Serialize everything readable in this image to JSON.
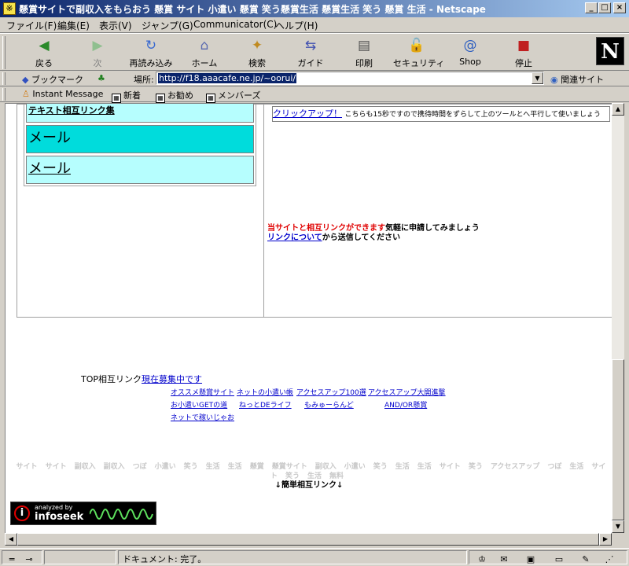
{
  "window": {
    "title": "懸賞サイトで副収入をもらおう 懸賞 サイト 小遣い 懸賞 笑う懸賞生活 懸賞生活 笑う 懸賞 生活 - Netscape",
    "minimize": "_",
    "maximize": "□",
    "close": "×"
  },
  "menu": [
    "ファイル(F)",
    "編集(E)",
    "表示(V)",
    "ジャンプ(G)",
    "Communicator(C)",
    "ヘルプ(H)"
  ],
  "toolbar": {
    "back": "戻る",
    "forward": "次",
    "reload": "再読み込み",
    "home": "ホーム",
    "search": "検索",
    "guide": "ガイド",
    "print": "印刷",
    "security": "セキュリティ",
    "shop": "Shop",
    "stop": "停止",
    "logo": "N"
  },
  "location": {
    "bookmarks": "ブックマーク",
    "label": "場所:",
    "url": "http://f18.aaacafe.ne.jp/~oorui/",
    "related": "関連サイト"
  },
  "personal": {
    "instant_message": "Instant Message",
    "new": "新着",
    "recommend": "お勧め",
    "members": "メンバーズ"
  },
  "page": {
    "left_cell1": "テキスト相互リンク集",
    "left_cell2": "メール",
    "left_cell3": "メール",
    "click_link": "クリックアップ！",
    "click_text": "こちらも15秒ですので携待時間をずらして上のツールとへ平行して使いましょう",
    "sogo_red": "当サイトと相互リンクができます",
    "sogo_black": "気軽に申請してみましょう",
    "link_about": "リンクについて",
    "link_about_rest": "から送信してください",
    "top_label": "TOP相互リンク",
    "top_now": "現在募集中です",
    "top_links": [
      "オススメ懸賞サイト",
      "ネットの小遣い帳",
      "アクセスアップ100選",
      "アクセスアップ大開進撃",
      "お小遣いGETの道",
      "ねっとDEライフ",
      "もみゅーらんど",
      "AND/OR懸賞",
      "ネットで稼いじゃお"
    ],
    "keywords": [
      "サイト",
      "サイト",
      "副収入",
      "副収入",
      "つぼ",
      "小遣い",
      "笑う",
      "生活",
      "生活",
      "懸賞",
      "懸賞サイト",
      "副収入",
      "小遣い",
      "笑う",
      "生活",
      "生活",
      "サイト",
      "笑う",
      "アクセスアップ",
      "つぼ",
      "生活",
      "サイト",
      "笑う",
      "生活",
      "無料"
    ],
    "simple_link": "↓簡単相互リンク↓",
    "infoseek_a": "analyzed by",
    "infoseek_b": "infoseek"
  },
  "status": {
    "text": "ドキュメント: 完了。"
  },
  "colors": {
    "cell_light": "#b6fefe",
    "cell_dark": "#00dcdc",
    "link": "#0000cc",
    "red": "#e00000"
  }
}
